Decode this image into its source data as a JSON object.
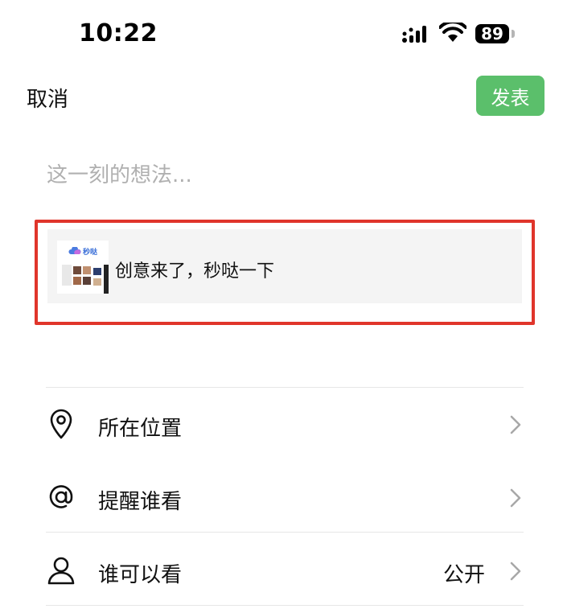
{
  "status_bar": {
    "time": "10:22",
    "battery": "89",
    "icons": [
      "signal-icon",
      "wifi-icon",
      "battery-icon"
    ]
  },
  "header": {
    "cancel_label": "取消",
    "post_label": "发表"
  },
  "compose": {
    "placeholder": "这一刻的想法..."
  },
  "link_card": {
    "thumb_brand": "秒哒",
    "title": "创意来了，秒哒一下"
  },
  "options": [
    {
      "icon": "location-pin-icon",
      "label": "所在位置",
      "value": ""
    },
    {
      "icon": "at-mention-icon",
      "label": "提醒谁看",
      "value": ""
    },
    {
      "icon": "person-icon",
      "label": "谁可以看",
      "value": "公开"
    }
  ],
  "colors": {
    "accent_green": "#5bbf6b",
    "highlight_red": "#e0352b",
    "placeholder_gray": "#b0b0b0",
    "card_bg": "#f4f4f4"
  }
}
